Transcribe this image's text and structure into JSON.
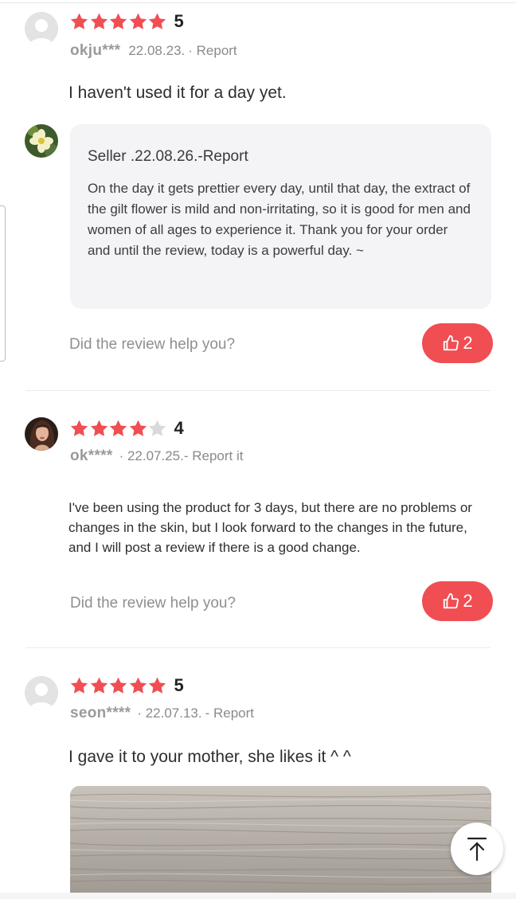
{
  "colors": {
    "star": "#f04e52",
    "star_empty": "#d9d9d9",
    "like_button": "#f04e52"
  },
  "reviews": [
    {
      "rating_text": "5",
      "rating": 5,
      "username": "okju***",
      "date": "22.08.23.",
      "report": "· Report",
      "text": "I haven't used it for a day yet.",
      "seller_reply": {
        "header": "Seller .22.08.26.-Report",
        "text": "On the day it gets prettier every day, until that day, the extract of the gilt flower is mild and non-irritating, so it is good for men and women of all ages to experience it. Thank you for your order and until the review, today is a powerful day. ~"
      },
      "helpful_question": "Did the review help you?",
      "like_count": "2",
      "like_icon": "thumbs-up-icon"
    },
    {
      "rating_text": "4",
      "rating": 4,
      "username": "ok****",
      "date": "· 22.07.25.",
      "report": "- Report it",
      "text": "I've been using the product for 3 days, but there are no problems or changes in the skin, but I look forward to the changes in the future, and I will post a review if there is a good change.",
      "helpful_question": "Did the review help you?",
      "like_count": "2",
      "like_icon": "thumbs-up-icon"
    },
    {
      "rating_text": "5",
      "rating": 5,
      "username": "seon****",
      "date": "· 22.07.13.",
      "report": "- Report",
      "text": "I gave it to your mother, she likes it ^ ^"
    }
  ],
  "back_to_top_icon": "arrow-up-to-top-icon"
}
